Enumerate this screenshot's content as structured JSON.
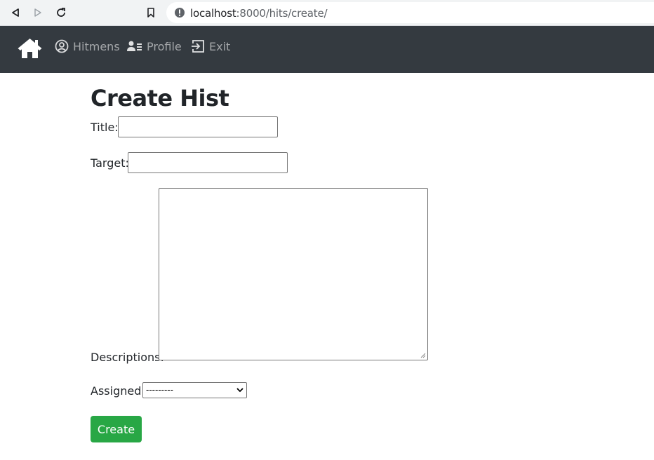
{
  "browser": {
    "url_host": "localhost",
    "url_path": ":8000/hits/create/"
  },
  "navbar": {
    "hitmens_label": "Hitmens",
    "profile_label": "Profile",
    "exit_label": "Exit"
  },
  "form": {
    "heading": "Create Hist",
    "title_label": "Title:",
    "title_value": "",
    "target_label": "Target:",
    "target_value": "",
    "descriptions_label": "Descriptions:",
    "descriptions_value": "",
    "assigned_label": "Assigned:",
    "assigned_selected": "---------",
    "submit_label": "Create"
  },
  "colors": {
    "navbar_bg": "#343a40",
    "nav_link": "rgba(255,255,255,0.55)",
    "submit_bg": "#28a745"
  },
  "icons": {
    "back": "back-arrow-icon",
    "forward": "forward-arrow-icon",
    "reload": "reload-icon",
    "bookmark": "bookmark-icon",
    "site_info": "info-icon",
    "home": "home-icon",
    "hitmens": "user-circle-icon",
    "profile": "user-list-icon",
    "exit": "exit-icon"
  }
}
